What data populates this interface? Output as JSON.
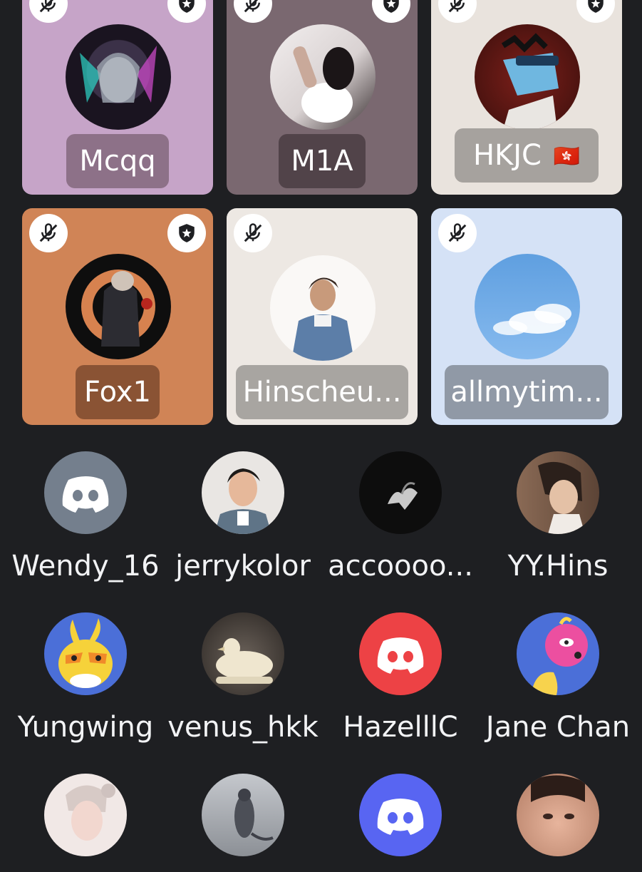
{
  "stage_tiles": [
    {
      "name": "Mcqq",
      "bg": "#c6a4c8",
      "pill": "#8d7188"
    },
    {
      "name": "M1A",
      "bg": "#7a6870",
      "pill": "#514349"
    },
    {
      "name": "HKJC",
      "flag": "🇭🇰",
      "bg": "#e9e3dd",
      "pill": "#a6a29e"
    },
    {
      "name": "Fox1",
      "bg": "#d08456",
      "pill": "#8a5334"
    },
    {
      "name": "Hinscheu...",
      "bg": "#ede8e3",
      "pill": "#a8a5a1"
    },
    {
      "name": "allmytim...",
      "bg": "#d5e2f6",
      "pill": "#9099a6"
    }
  ],
  "audience": [
    {
      "name": "Wendy_16",
      "avatar": "discord-logo",
      "color": "#747f8d"
    },
    {
      "name": "jerrykolor",
      "avatar": "photo",
      "color": "#bfb0a1"
    },
    {
      "name": "accoooo...",
      "avatar": "photo",
      "color": "#0d0d0d"
    },
    {
      "name": "YY.Hins",
      "avatar": "photo",
      "color": "#8c6c57"
    },
    {
      "name": "Yungwing",
      "avatar": "illustration",
      "color": "#4b6fd8"
    },
    {
      "name": "venus_hkk",
      "avatar": "photo",
      "color": "#5a524a"
    },
    {
      "name": "HazelllC",
      "avatar": "discord-logo",
      "color": "#ed4245"
    },
    {
      "name": "Jane Chan",
      "avatar": "illustration",
      "color": "#4b6fd8"
    },
    {
      "name": "",
      "avatar": "photo",
      "color": "#e8d5d0"
    },
    {
      "name": "",
      "avatar": "photo",
      "color": "#a7aab0"
    },
    {
      "name": "",
      "avatar": "discord-logo",
      "color": "#5865f2"
    },
    {
      "name": "",
      "avatar": "photo",
      "color": "#d8a890"
    }
  ]
}
